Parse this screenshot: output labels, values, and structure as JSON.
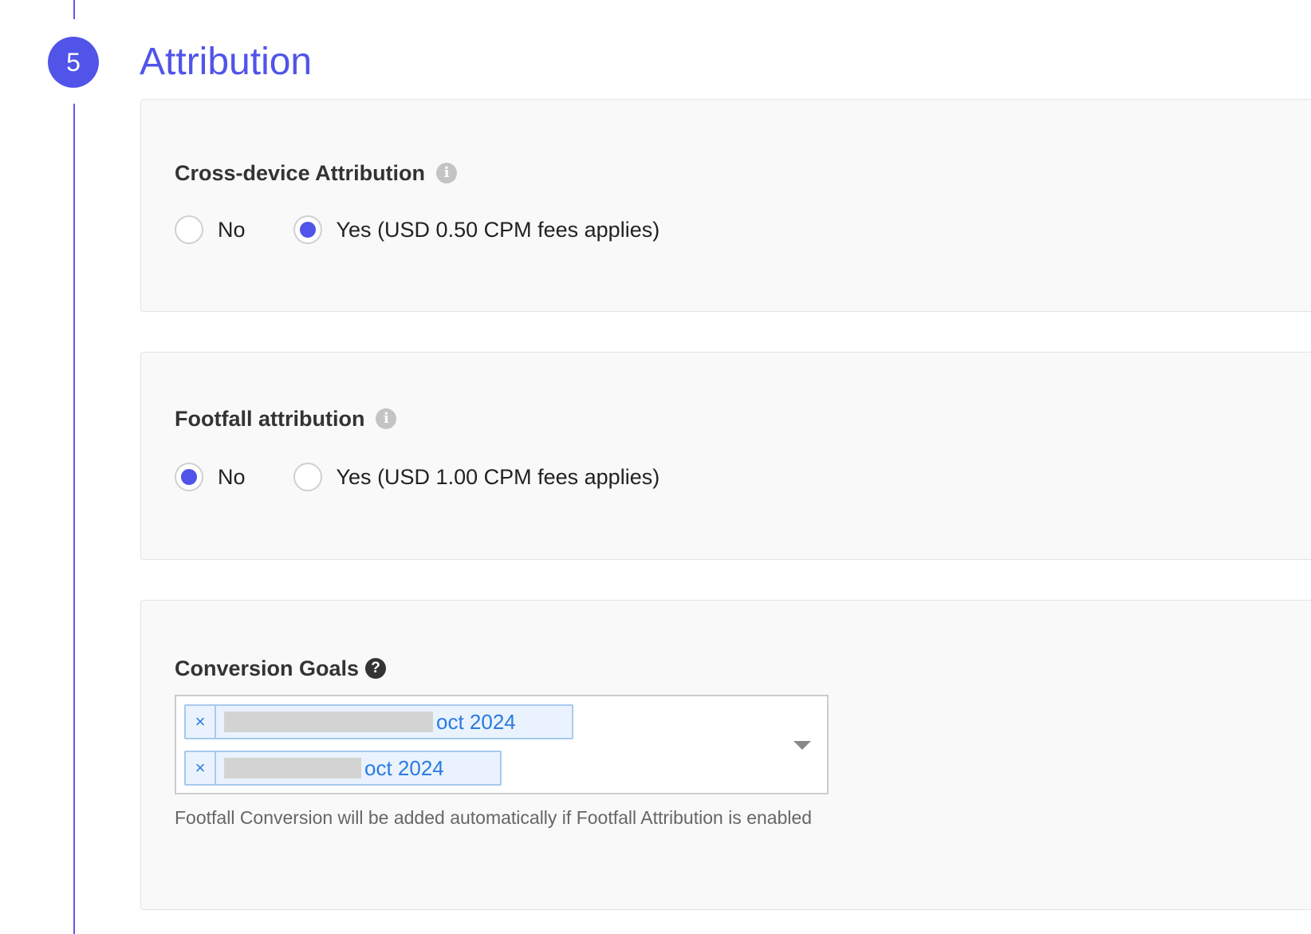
{
  "step": {
    "number": "5",
    "title": "Attribution"
  },
  "accent_color": "#5154e8",
  "cross_device": {
    "label": "Cross-device Attribution",
    "info_icon": "i",
    "options": [
      {
        "label": "No",
        "selected": false
      },
      {
        "label": "Yes (USD 0.50 CPM fees applies)",
        "selected": true
      }
    ]
  },
  "footfall": {
    "label": "Footfall attribution",
    "info_icon": "i",
    "options": [
      {
        "label": "No",
        "selected": true
      },
      {
        "label": "Yes (USD 1.00 CPM fees applies)",
        "selected": false
      }
    ]
  },
  "conversion_goals": {
    "label": "Conversion Goals",
    "help_icon": "?",
    "remove_symbol": "×",
    "tags": [
      {
        "text": "oct 2024",
        "redacted": true
      },
      {
        "text": "oct 2024",
        "redacted": true
      }
    ],
    "help_text": "Footfall Conversion will be added automatically if Footfall Attribution is enabled"
  }
}
